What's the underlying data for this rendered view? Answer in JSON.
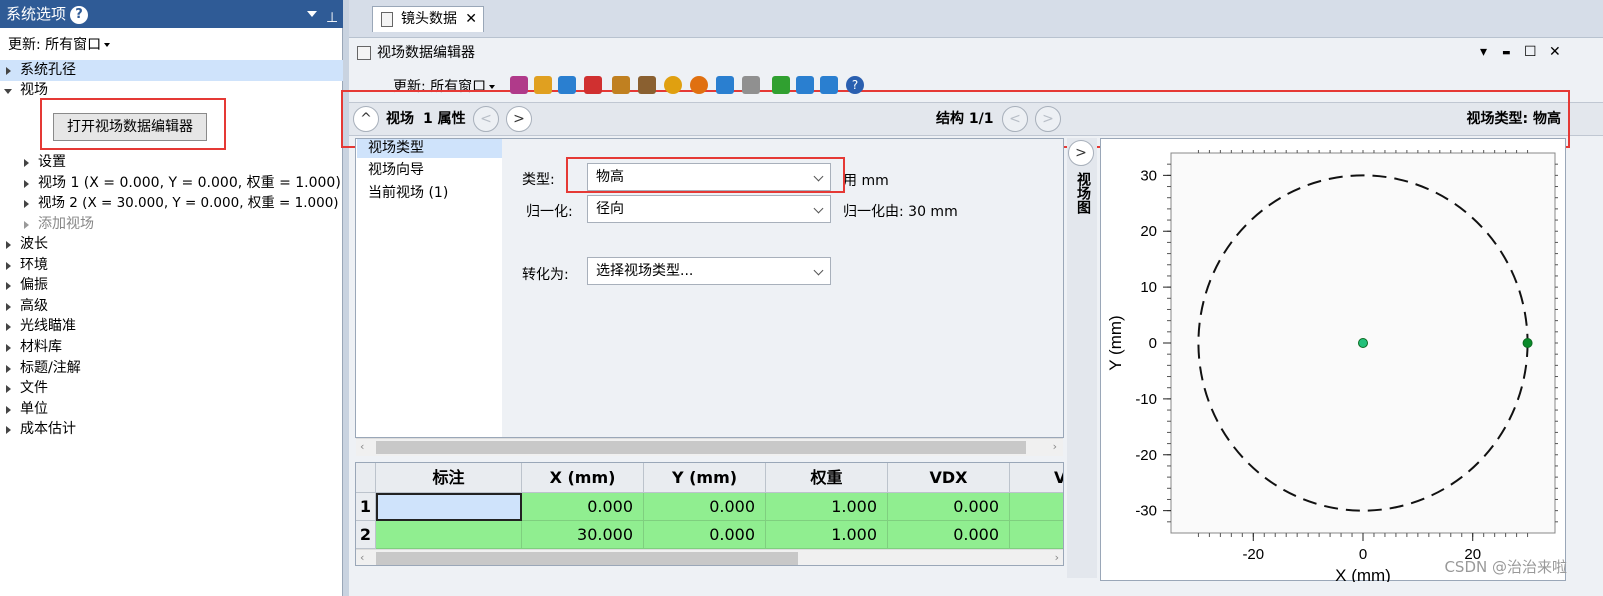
{
  "left_panel": {
    "title": "系统选项",
    "help_icon": "?",
    "update_label": "更新: 所有窗口",
    "tree": {
      "aperture": "系统孔径",
      "field": "视场",
      "open_editor_button": "打开视场数据编辑器",
      "settings": "设置",
      "field1": "视场 1 (X = 0.000, Y = 0.000, 权重 = 1.000)",
      "field2": "视场 2 (X = 30.000, Y = 0.000, 权重 = 1.000)",
      "add_field": "添加视场",
      "wavelength": "波长",
      "environment": "环境",
      "polarization": "偏振",
      "advanced": "高级",
      "ray_aiming": "光线瞄准",
      "material_library": "材料库",
      "title_notes": "标题/注解",
      "files": "文件",
      "units": "单位",
      "cost_estimate": "成本估计"
    }
  },
  "document_tab": {
    "label": "镜头数据",
    "close": "✕"
  },
  "editor": {
    "title": "视场数据编辑器",
    "window_controls": {
      "menu": "▾",
      "minimize": "▬",
      "maximize": "☐",
      "close": "✕"
    },
    "toolbar": {
      "update_label": "更新: 所有窗口",
      "icon_colors": [
        "#b03a8a",
        "#e0a020",
        "#2a7fd0",
        "#d03030",
        "#c08020",
        "#8a6030",
        "#e0a010",
        "#e07010",
        "#2a7fd0",
        "#909090",
        "#30a030",
        "#2a7fd0",
        "#2a7fd0",
        "#2a5fb0"
      ]
    },
    "nav": {
      "collapse_icon": "^",
      "section_label": "视场",
      "property_label": "1 属性",
      "prev_icon": "<",
      "next_icon": ">",
      "config_label": "结构 1/1",
      "field_type_label": "视场类型: 物高"
    },
    "nav_list": [
      "视场类型",
      "视场向导",
      "当前视场 (1)"
    ],
    "form": {
      "type_label": "类型:",
      "type_value": "物高",
      "type_unit": "用 mm",
      "normalize_label": "归一化:",
      "normalize_value": "径向",
      "normalize_by": "归一化由: 30 mm",
      "convert_label": "转化为:",
      "convert_value": "选择视场类型..."
    },
    "grid": {
      "columns": [
        "标注",
        "X (mm)",
        "Y (mm)",
        "权重",
        "VDX",
        "V"
      ],
      "rows": [
        {
          "num": "1",
          "label": "",
          "x": "0.000",
          "y": "0.000",
          "weight": "1.000",
          "vdx": "0.000"
        },
        {
          "num": "2",
          "label": "",
          "x": "30.000",
          "y": "0.000",
          "weight": "1.000",
          "vdx": "0.000"
        }
      ]
    },
    "side_tab": "视场图"
  },
  "watermark": "CSDN @治治来啦",
  "chart_data": {
    "type": "scatter",
    "xlabel": "X (mm)",
    "ylabel": "Y (mm)",
    "xlim": [
      -35,
      35
    ],
    "ylim": [
      -34,
      34
    ],
    "x_ticks": [
      -20,
      0,
      20
    ],
    "y_ticks": [
      30,
      20,
      10,
      0,
      -10,
      -20,
      -30
    ],
    "circle_radius": 30,
    "points": [
      {
        "x": 0,
        "y": 0,
        "color": "#22c07a"
      },
      {
        "x": 30,
        "y": 0,
        "color": "#0a8a2a"
      }
    ]
  }
}
